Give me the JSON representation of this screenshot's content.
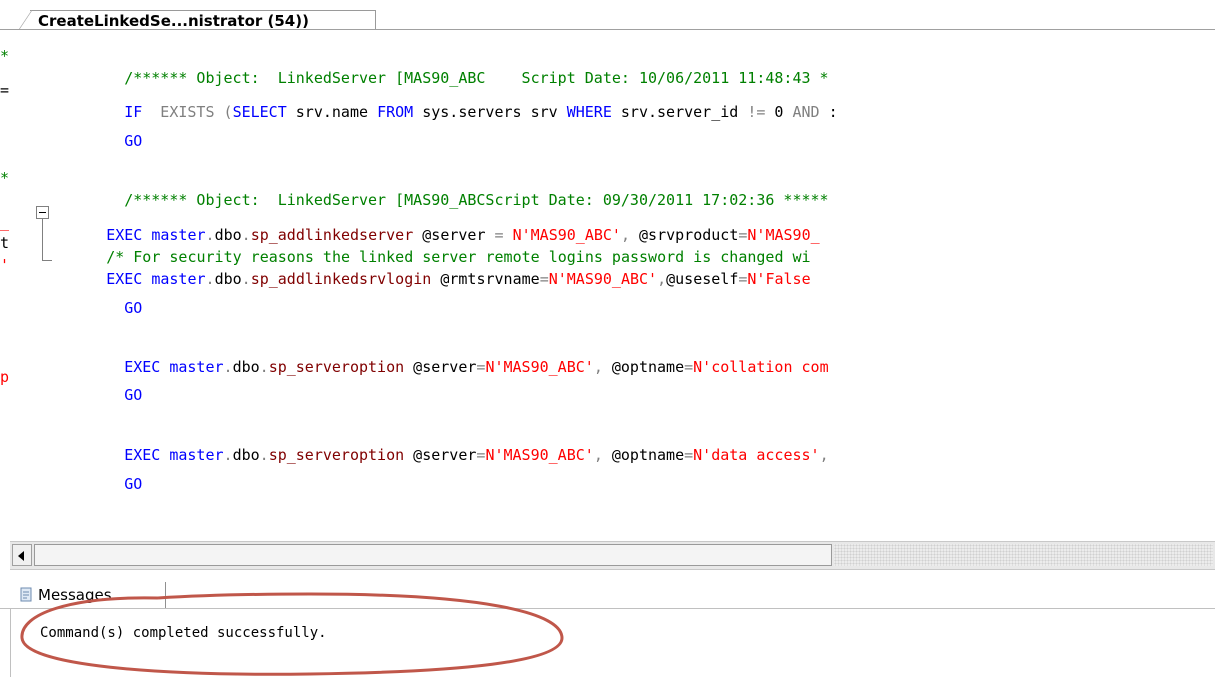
{
  "tab": {
    "title": "CreateLinkedSe...nistrator (54))"
  },
  "gutter": [
    "*",
    "=",
    "*",
    "_",
    "t",
    "'",
    "p"
  ],
  "code": {
    "l1": [
      "/****** Object:  LinkedServer [MAS90_ABC    Script Date: 10/06/2011 11:48:43 *"
    ],
    "l2": [
      "IF",
      "  EXISTS ",
      "(",
      "SELECT",
      " srv.name ",
      "FROM",
      " sys.servers srv ",
      "WHERE",
      " srv.server_id ",
      "!=",
      " 0 ",
      "AND",
      " :"
    ],
    "l3": [
      "GO"
    ],
    "l5": [
      "/****** Object:  LinkedServer [MAS90_ABCScript Date: 09/30/2011 17:02:36 *****"
    ],
    "l6": [
      "EXEC",
      " master",
      ".",
      "dbo",
      ".",
      "sp_addlinkedserver",
      " @server ",
      "=",
      " ",
      "N'MAS90_ABC'",
      ",",
      " @srvproduct",
      "=",
      "N'MAS90_"
    ],
    "l7": [
      "/* For security reasons the linked server remote logins password is changed wi"
    ],
    "l8": [
      "EXEC",
      " master",
      ".",
      "dbo",
      ".",
      "sp_addlinkedsrvlogin",
      " @rmtsrvname",
      "=",
      "N'MAS90_ABC'",
      ",",
      "@useself",
      "=",
      "N'False"
    ],
    "l9": [
      "GO"
    ],
    "l11": [
      "EXEC",
      " master",
      ".",
      "dbo",
      ".",
      "sp_serveroption",
      " @server",
      "=",
      "N'MAS90_ABC'",
      ",",
      " @optname",
      "=",
      "N'collation com"
    ],
    "l12": [
      "GO"
    ],
    "l14": [
      "EXEC",
      " master",
      ".",
      "dbo",
      ".",
      "sp_serveroption",
      " @server",
      "=",
      "N'MAS90_ABC'",
      ",",
      " @optname",
      "=",
      "N'data access'",
      ","
    ],
    "l15": [
      "GO"
    ]
  },
  "messages": {
    "tab_label": "Messages",
    "text": "Command(s) completed successfully."
  },
  "colors": {
    "keyword": "#0000ff",
    "string": "#ff0000",
    "system_proc": "#800000",
    "comment": "#008000",
    "annotation": "#c0574a"
  }
}
